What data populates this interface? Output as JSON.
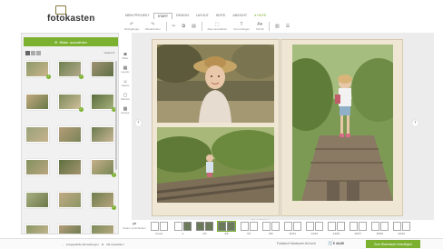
{
  "header": {
    "logo_text": "fotokasten"
  },
  "menu": {
    "tabs": [
      {
        "label": "MEIN PROJEKT"
      },
      {
        "label": "START"
      },
      {
        "label": "DESIGN"
      },
      {
        "label": "LAYOUT"
      },
      {
        "label": "SEITE"
      },
      {
        "label": "ANSICHT"
      },
      {
        "label": "HILFE"
      }
    ]
  },
  "toolbar": {
    "undo_label": "Rückgängig",
    "redo_label": "Wiederholen",
    "select_all_label": "Alles auswählen",
    "insert_text_label": "Text einfügen",
    "font_label": "Schrift"
  },
  "left_panel": {
    "add_photos_label": "Bilder auswählen",
    "sort_label": "sortiert"
  },
  "tools": [
    {
      "icon": "camera-icon",
      "label": "Bilder"
    },
    {
      "icon": "layout-icon",
      "label": "Layouts"
    },
    {
      "icon": "clipart-icon",
      "label": "Cliparts"
    },
    {
      "icon": "frame-icon",
      "label": "Rahmen"
    },
    {
      "icon": "background-icon",
      "label": "Hintergr."
    }
  ],
  "canvas": {
    "hint": "Die markierten Randbereiche können bei der Produktion abgeschnitten werden."
  },
  "strip": {
    "select_all_label": "Seiten verschieben",
    "spreads": [
      {
        "label": "Cover"
      },
      {
        "label": "1"
      },
      {
        "label": "2/3"
      },
      {
        "label": "4/5"
      },
      {
        "label": "6/7"
      },
      {
        "label": "8/9"
      },
      {
        "label": "10/11"
      },
      {
        "label": "12/13"
      },
      {
        "label": "14/15"
      },
      {
        "label": "16/17"
      },
      {
        "label": "18/19"
      },
      {
        "label": "20/21"
      }
    ]
  },
  "footer": {
    "zoom_label": "Ausgewählte Einstellungen",
    "magnify_label": "Mit auswählen",
    "product": "Fotobuch Hardcover A4 hoch",
    "price": "€ 44,90",
    "add_to_cart": "Zum Warenkorb hinzufügen"
  },
  "colors": {
    "accent": "#7bb12f",
    "page_paper": "#f0e6d4"
  }
}
